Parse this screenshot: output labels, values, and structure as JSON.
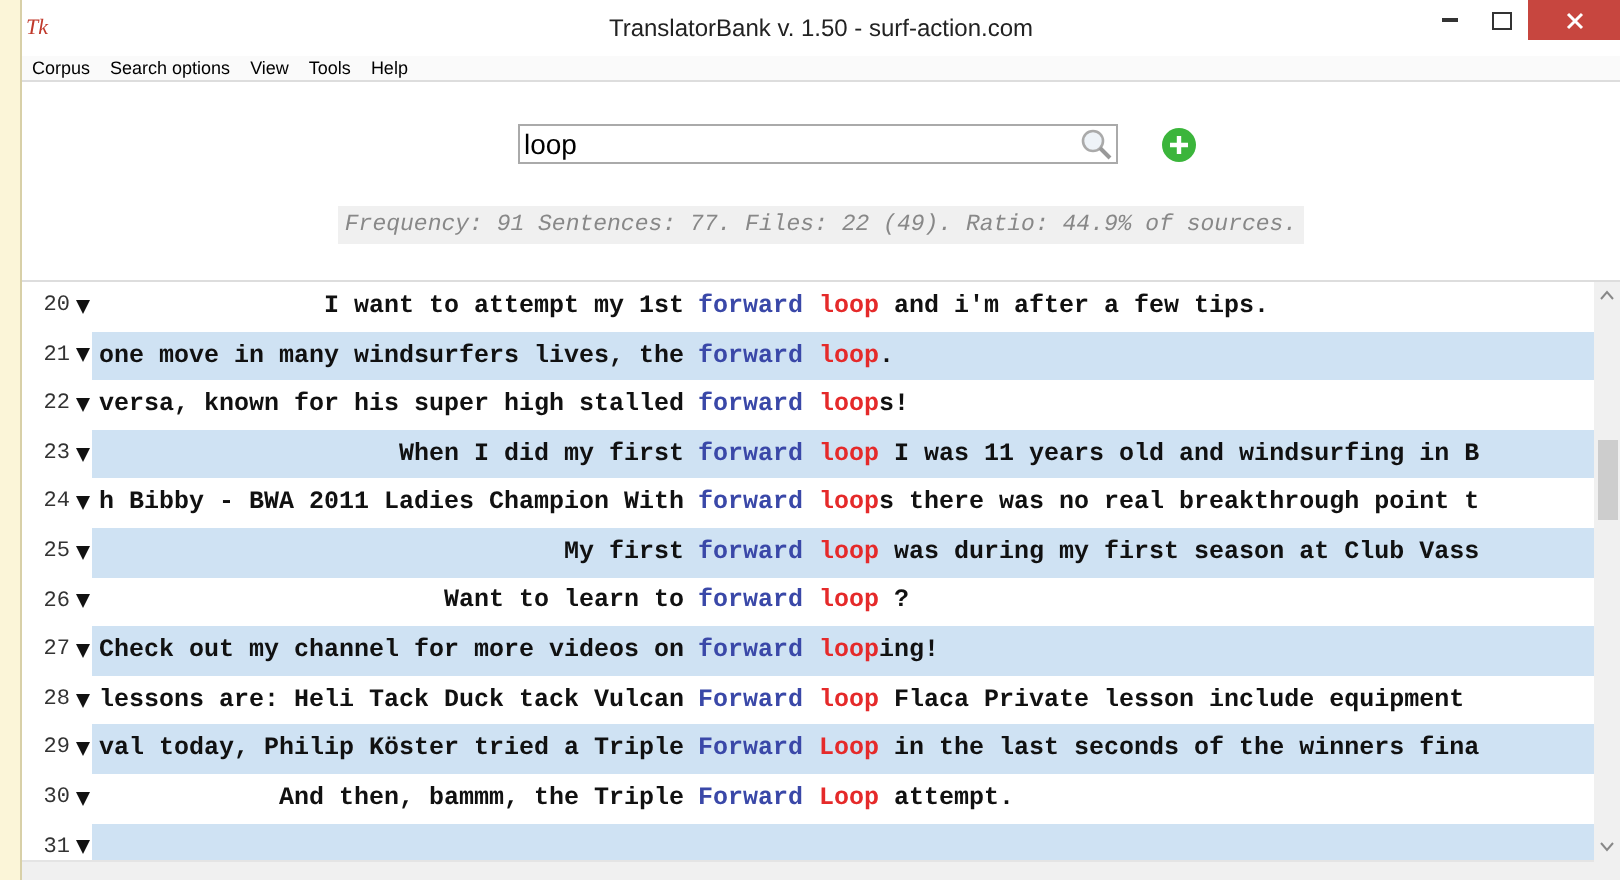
{
  "window": {
    "title": "TranslatorBank v. 1.50 - surf-action.com",
    "app_icon": "Tk"
  },
  "menu": [
    "Corpus",
    "Search options",
    "View",
    "Tools",
    "Help"
  ],
  "search": {
    "value": "loop"
  },
  "stats": "Frequency: 91 Sentences: 77. Files: 22 (49). Ratio: 44.9% of sources.",
  "rows": [
    {
      "number": "20",
      "left": "I want to attempt my 1st",
      "node": [
        "forward",
        "loop"
      ],
      "right": " and i'm after a few tips."
    },
    {
      "number": "21",
      "left": "one move in many windsurfers lives, the",
      "node": [
        "forward",
        "loop"
      ],
      "right": "."
    },
    {
      "number": "22",
      "left": "versa, known for his super high stalled",
      "node": [
        "forward",
        "loop"
      ],
      "right": "s!"
    },
    {
      "number": "23",
      "left": "When I did my first",
      "node": [
        "forward",
        "loop"
      ],
      "right": " I was 11 years old and windsurfing in B"
    },
    {
      "number": "24",
      "left": "h Bibby - BWA 2011 Ladies Champion With",
      "node": [
        "forward",
        "loop"
      ],
      "right": "s there was no real breakthrough point t"
    },
    {
      "number": "25",
      "left": "My first",
      "node": [
        "forward",
        "loop"
      ],
      "right": " was during my first season at Club Vass"
    },
    {
      "number": "26",
      "left": "Want to learn to",
      "node": [
        "forward",
        "loop"
      ],
      "right": " ?"
    },
    {
      "number": "27",
      "left": "Check out my channel for more videos on",
      "node": [
        "forward",
        "loop"
      ],
      "right": "ing!"
    },
    {
      "number": "28",
      "left": "lessons are: Heli Tack Duck tack Vulcan",
      "node": [
        "Forward",
        "loop"
      ],
      "right": " Flaca Private lesson include equipment"
    },
    {
      "number": "29",
      "left": "val today, Philip Köster tried a Triple",
      "node": [
        "Forward",
        "Loop"
      ],
      "right": " in the last seconds of the winners fina"
    },
    {
      "number": "30",
      "left": "And then, bammm, the Triple",
      "node": [
        "Forward",
        "Loop"
      ],
      "right": " attempt."
    },
    {
      "number": "31"
    }
  ]
}
